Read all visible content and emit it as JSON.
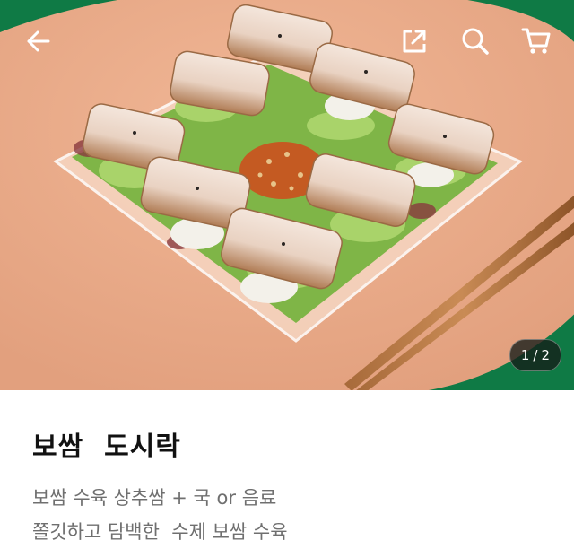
{
  "header": {
    "back_icon": "arrow-left-icon",
    "share_icon": "share-external-icon",
    "search_icon": "search-icon",
    "cart_icon": "cart-icon"
  },
  "gallery": {
    "image_subject": "bossam-lunchbox-photo",
    "current": "1",
    "separator": "/",
    "total": "2"
  },
  "product": {
    "title": "보쌈  도시락",
    "description_line1": "보쌈 수육 상추쌈 + 국 or 음료",
    "description_line2": "쫄깃하고 담백한  수제 보쌈 수육"
  },
  "colors": {
    "background_green": "#0f7a45",
    "placemat_peach": "#e9a986",
    "title_text": "#111111",
    "description_text": "#6f6f6f"
  }
}
